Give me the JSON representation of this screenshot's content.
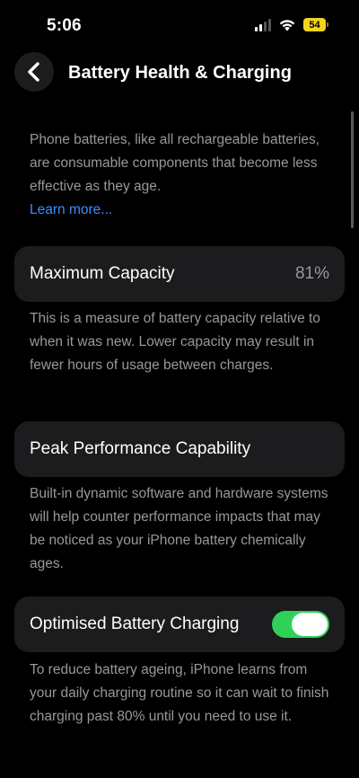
{
  "status_bar": {
    "time": "5:06",
    "battery_level": "54",
    "icons": [
      "signal-icon",
      "wifi-icon",
      "battery-icon"
    ]
  },
  "nav": {
    "back_icon": "chevron-left-icon",
    "title": "Battery Health & Charging"
  },
  "intro": {
    "text": "Phone batteries, like all rechargeable batteries, are consumable components that become less effective as they age.",
    "link": "Learn more..."
  },
  "maximum_capacity": {
    "label": "Maximum Capacity",
    "value": "81%",
    "description": "This is a measure of battery capacity relative to when it was new. Lower capacity may result in fewer hours of usage between charges."
  },
  "peak_performance": {
    "label": "Peak Performance Capability",
    "description": "Built-in dynamic software and hardware systems will help counter performance impacts that may be noticed as your iPhone battery chemically ages."
  },
  "optimised_charging": {
    "label": "Optimised Battery Charging",
    "enabled": true,
    "description": "To reduce battery ageing, iPhone learns from your daily charging routine so it can wait to finish charging past 80% until you need to use it."
  },
  "colors": {
    "background": "#000000",
    "card": "#1c1c1e",
    "secondary_text": "#98989d",
    "link": "#3d8bff",
    "toggle_on": "#30d158",
    "battery": "#f2d51c"
  }
}
